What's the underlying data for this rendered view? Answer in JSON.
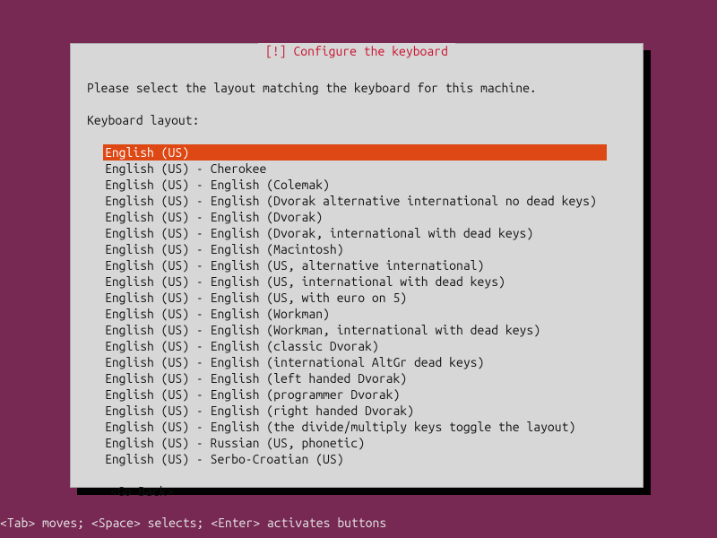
{
  "title": "[!] Configure the keyboard",
  "instruction": "Please select the layout matching the keyboard for this machine.",
  "label": "Keyboard layout:",
  "selectedIndex": 0,
  "layouts": [
    "English (US)",
    "English (US) - Cherokee",
    "English (US) - English (Colemak)",
    "English (US) - English (Dvorak alternative international no dead keys)",
    "English (US) - English (Dvorak)",
    "English (US) - English (Dvorak, international with dead keys)",
    "English (US) - English (Macintosh)",
    "English (US) - English (US, alternative international)",
    "English (US) - English (US, international with dead keys)",
    "English (US) - English (US, with euro on 5)",
    "English (US) - English (Workman)",
    "English (US) - English (Workman, international with dead keys)",
    "English (US) - English (classic Dvorak)",
    "English (US) - English (international AltGr dead keys)",
    "English (US) - English (left handed Dvorak)",
    "English (US) - English (programmer Dvorak)",
    "English (US) - English (right handed Dvorak)",
    "English (US) - English (the divide/multiply keys toggle the layout)",
    "English (US) - Russian (US, phonetic)",
    "English (US) - Serbo-Croatian (US)"
  ],
  "goback": "<Go Back>",
  "hint": "<Tab> moves; <Space> selects; <Enter> activates buttons"
}
